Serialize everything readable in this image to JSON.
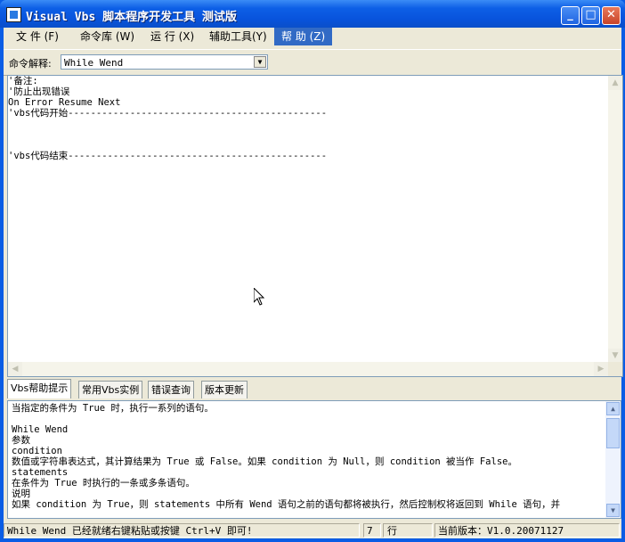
{
  "window": {
    "title": "Visual Vbs 脚本程序开发工具 测试版",
    "controls": [
      "_",
      "□",
      "✕"
    ]
  },
  "menu": [
    {
      "label": "文 件 (F)"
    },
    {
      "label": "命令库 (W)"
    },
    {
      "label": "运 行 (X)"
    },
    {
      "label": "辅助工具(Y)"
    },
    {
      "label": "帮 助 (Z)",
      "active": true
    }
  ],
  "command_bar": {
    "label": "命令解释:",
    "selected": "While Wend"
  },
  "editor": {
    "lines": [
      "'备注:",
      "'防止出现错误",
      "On Error Resume Next",
      "'vbs代码开始----------------------------------------------",
      "",
      "",
      "",
      "'vbs代码结束----------------------------------------------"
    ]
  },
  "tabs": [
    {
      "label": "Vbs帮助提示",
      "selected": true
    },
    {
      "label": "常用Vbs实例"
    },
    {
      "label": "错误查询"
    },
    {
      "label": "版本更新"
    }
  ],
  "help": {
    "lines": [
      "当指定的条件为 True 时，执行一系列的语句。",
      "",
      "While Wend",
      "参数",
      "condition",
      "数值或字符串表达式，其计算结果为 True 或 False。如果 condition 为 Null，则 condition 被当作 False。",
      "statements",
      "在条件为 True 时执行的一条或多条语句。",
      "说明",
      "如果 condition 为 True，则 statements 中所有 Wend 语句之前的语句都将被执行，然后控制权将返回到 While 语句，并"
    ]
  },
  "status": {
    "message": "While Wend 已经就绪右键粘贴或按键 Ctrl+V 即可!",
    "line_number": "7",
    "line_label": "行",
    "version": "当前版本：V1.0.20071127"
  },
  "colors": {
    "titlebar": "#0853dc",
    "menu_active": "#316ac5",
    "face": "#ece9d8"
  }
}
